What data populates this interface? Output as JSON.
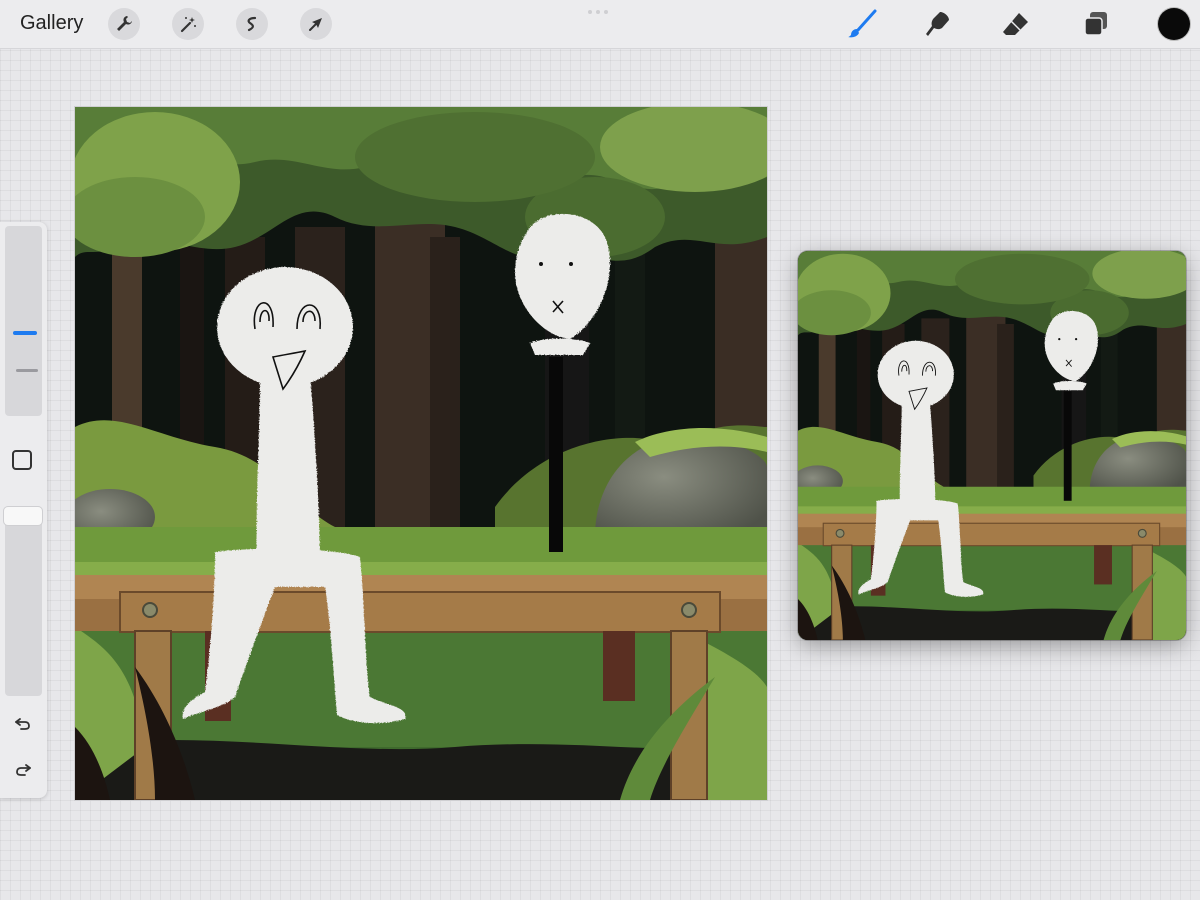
{
  "toolbar": {
    "gallery_label": "Gallery",
    "left_tools": [
      "wrench-icon",
      "magic-wand-icon",
      "selection-icon",
      "transform-arrow-icon"
    ],
    "right_tools": [
      "brush-icon",
      "smudge-icon",
      "eraser-icon",
      "layers-icon"
    ],
    "active_tool": "brush-icon",
    "current_color": "#0a0a0a",
    "accent_color": "#1e7bf0"
  },
  "sidebar": {
    "brush_size_level": 0.3,
    "opacity_level": 0.06,
    "controls": [
      "size-slider",
      "modify-button",
      "opacity-slider",
      "undo-icon",
      "redo-icon"
    ]
  },
  "canvas": {
    "artwork": "forest-bench-scene"
  },
  "reference_window": {
    "artwork": "forest-bench-scene"
  }
}
